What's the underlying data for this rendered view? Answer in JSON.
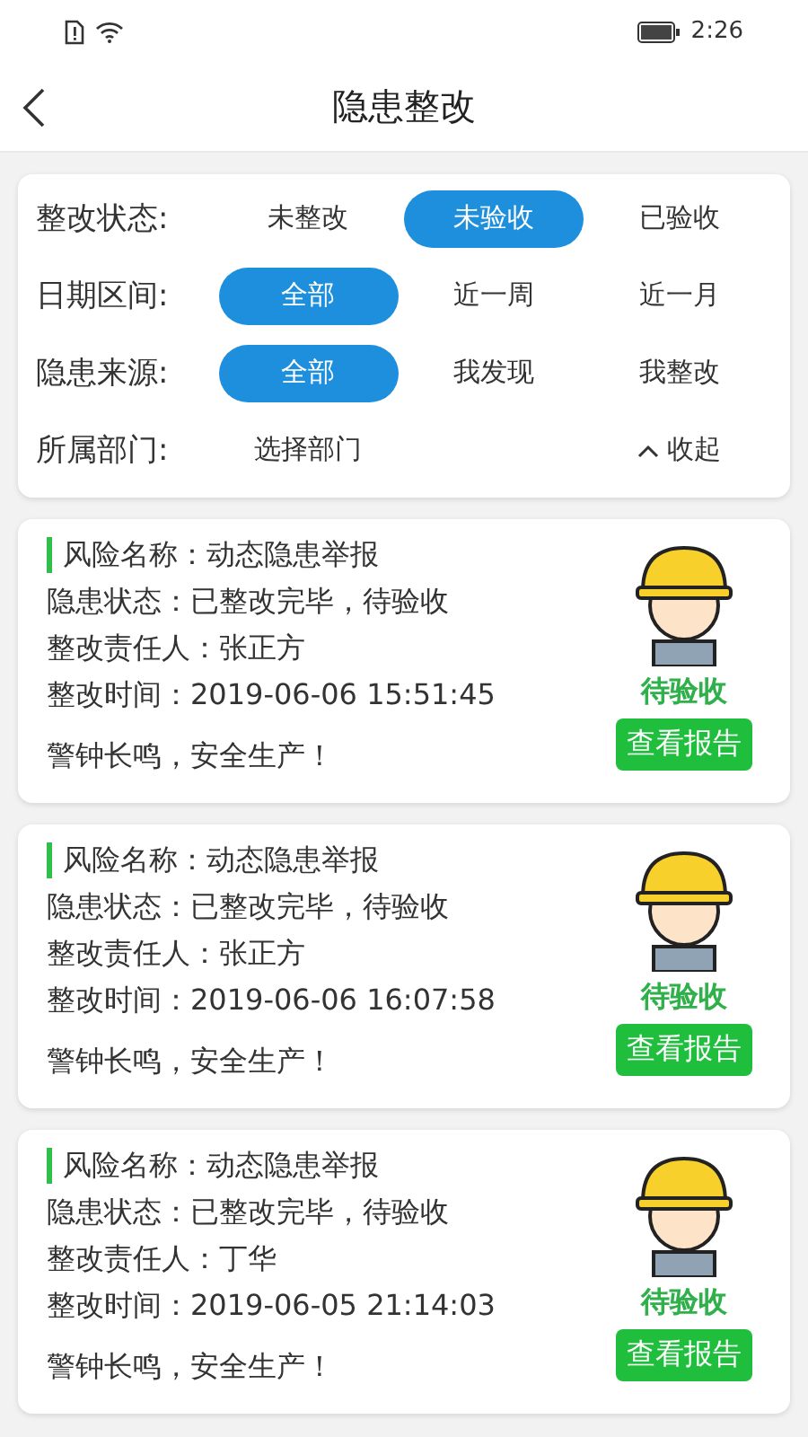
{
  "status_bar": {
    "time": "2:26"
  },
  "header": {
    "title": "隐患整改"
  },
  "filters": [
    {
      "label": "整改状态:",
      "options": [
        {
          "text": "未整改",
          "selected": false
        },
        {
          "text": "未验收",
          "selected": true
        },
        {
          "text": "已验收",
          "selected": false
        }
      ]
    },
    {
      "label": "日期区间:",
      "options": [
        {
          "text": "全部",
          "selected": true
        },
        {
          "text": "近一周",
          "selected": false
        },
        {
          "text": "近一月",
          "selected": false
        }
      ]
    },
    {
      "label": "隐患来源:",
      "options": [
        {
          "text": "全部",
          "selected": true
        },
        {
          "text": "我发现",
          "selected": false
        },
        {
          "text": "我整改",
          "selected": false
        }
      ]
    }
  ],
  "department": {
    "label": "所属部门:",
    "placeholder": "选择部门",
    "toggle": "收起",
    "expanded": true
  },
  "records": [
    {
      "lines": [
        "风险名称：动态隐患举报",
        "隐患状态：已整改完毕，待验收",
        "整改责任人：张正方",
        "整改时间：2019-06-06 15:51:45"
      ],
      "slogan": "警钟长鸣，安全生产！",
      "status": "待验收",
      "button": "查看报告"
    },
    {
      "lines": [
        "风险名称：动态隐患举报",
        "隐患状态：已整改完毕，待验收",
        "整改责任人：张正方",
        "整改时间：2019-06-06 16:07:58"
      ],
      "slogan": "警钟长鸣，安全生产！",
      "status": "待验收",
      "button": "查看报告"
    },
    {
      "lines": [
        "风险名称：动态隐患举报",
        "隐患状态：已整改完毕，待验收",
        "整改责任人：丁华",
        "整改时间：2019-06-05 21:14:03"
      ],
      "slogan": "警钟长鸣，安全生产！",
      "status": "待验收",
      "button": "查看报告"
    }
  ]
}
